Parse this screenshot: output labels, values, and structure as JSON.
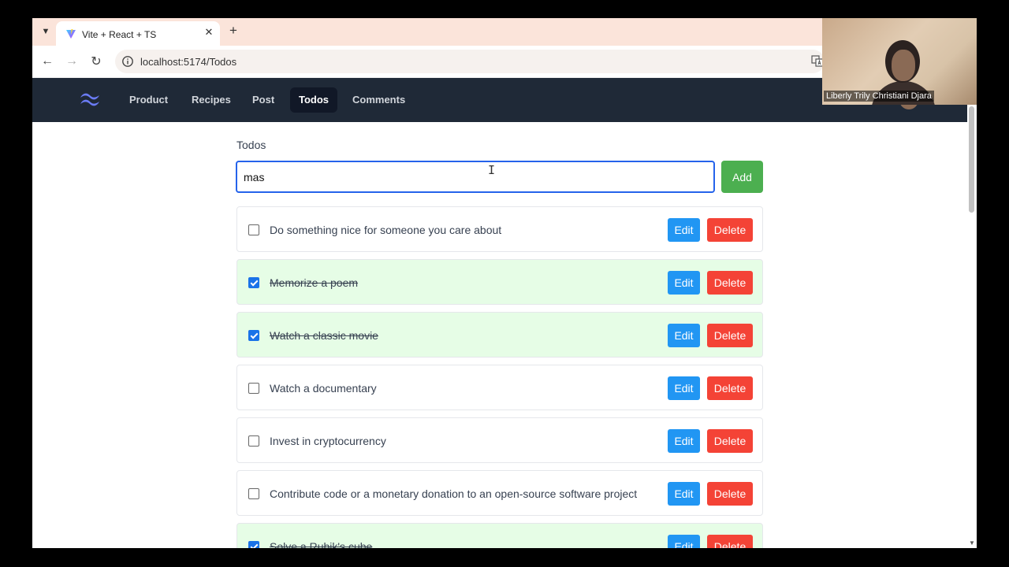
{
  "browser": {
    "tab_title": "Vite + React + TS",
    "url": "localhost:5174/Todos"
  },
  "navbar": {
    "links": [
      {
        "label": "Product",
        "active": false
      },
      {
        "label": "Recipes",
        "active": false
      },
      {
        "label": "Post",
        "active": false
      },
      {
        "label": "Todos",
        "active": true
      },
      {
        "label": "Comments",
        "active": false
      }
    ]
  },
  "main": {
    "heading": "Todos",
    "input_value": "mas",
    "add_label": "Add",
    "edit_label": "Edit",
    "delete_label": "Delete",
    "todos": [
      {
        "text": "Do something nice for someone you care about",
        "completed": false
      },
      {
        "text": "Memorize a poem",
        "completed": true
      },
      {
        "text": "Watch a classic movie",
        "completed": true
      },
      {
        "text": "Watch a documentary",
        "completed": false
      },
      {
        "text": "Invest in cryptocurrency",
        "completed": false
      },
      {
        "text": "Contribute code or a monetary donation to an open-source software project",
        "completed": false
      },
      {
        "text": "Solve a Rubik's cube",
        "completed": true
      }
    ]
  },
  "webcam": {
    "name": "Liberly Trily Christiani Djara"
  },
  "colors": {
    "navbar_bg": "#1f2937",
    "add_button": "#4caf50",
    "edit_button": "#2196f3",
    "delete_button": "#f44336",
    "completed_bg": "#e6fde6",
    "input_focus_border": "#2563eb"
  }
}
